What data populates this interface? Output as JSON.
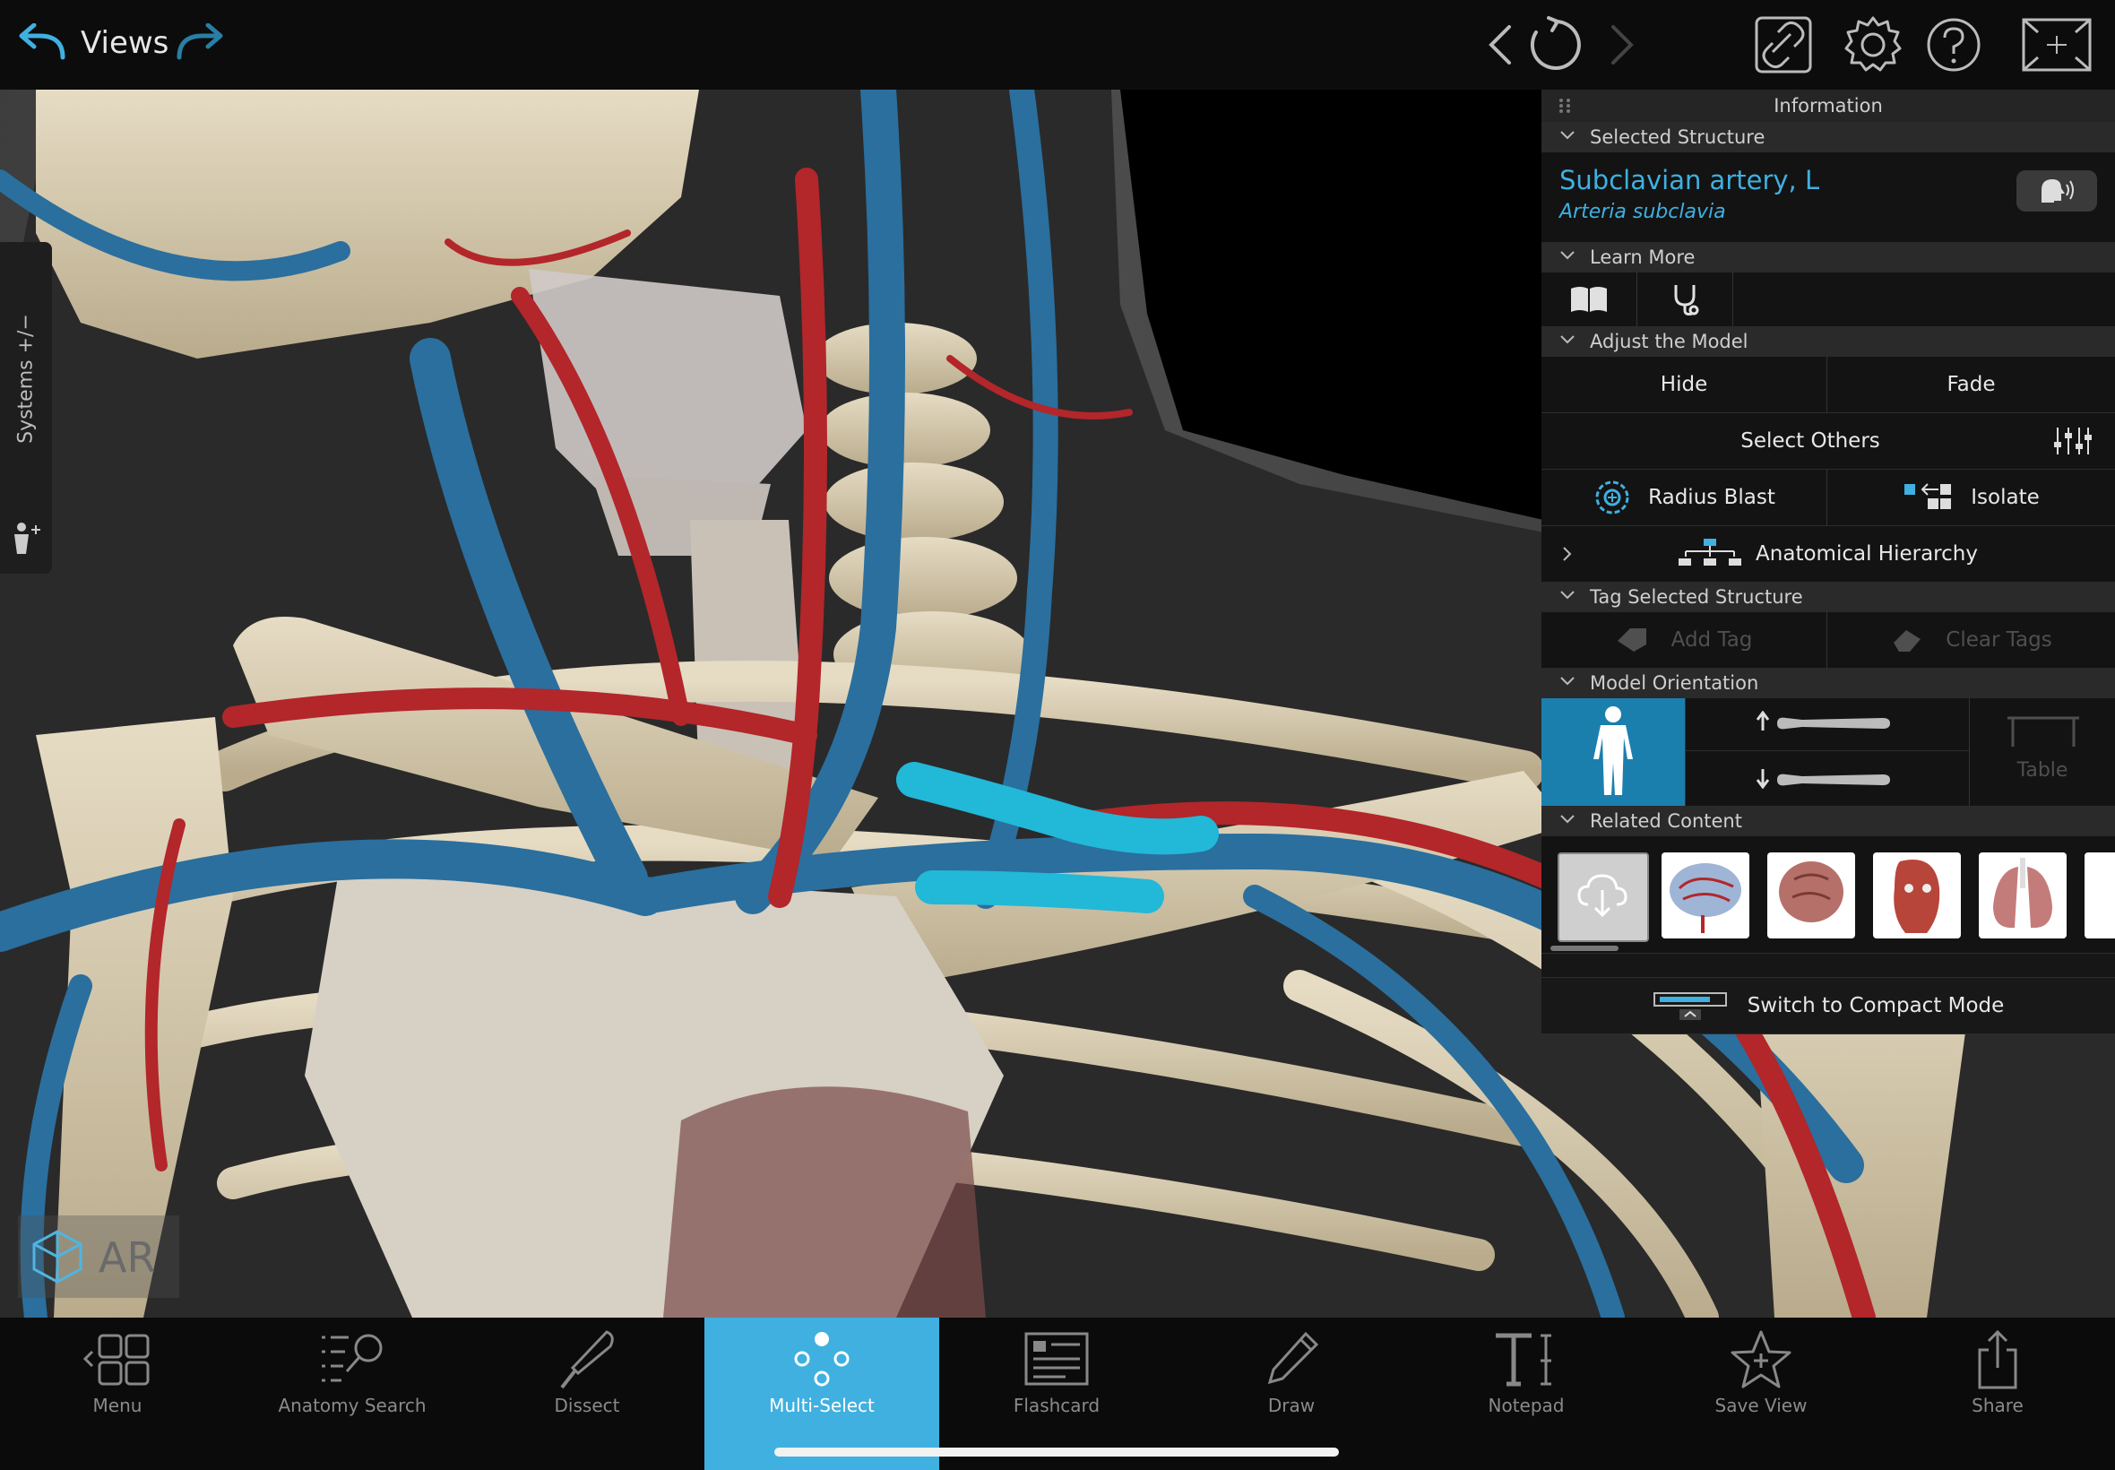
{
  "topbar": {
    "views_label": "Views"
  },
  "systems_tab": {
    "label": "Systems +/−"
  },
  "ar_badge": {
    "label": "AR"
  },
  "panel": {
    "title": "Information",
    "selected_structure": {
      "header": "Selected Structure",
      "name": "Subclavian artery, L",
      "latin": "Arteria subclavia"
    },
    "learn_more": {
      "header": "Learn More"
    },
    "adjust_model": {
      "header": "Adjust the Model",
      "hide": "Hide",
      "fade": "Fade",
      "select_others": "Select Others",
      "radius_blast": "Radius Blast",
      "isolate": "Isolate",
      "anatomical_hierarchy": "Anatomical Hierarchy"
    },
    "tag_structure": {
      "header": "Tag Selected Structure",
      "add_tag": "Add Tag",
      "clear_tags": "Clear Tags"
    },
    "model_orientation": {
      "header": "Model Orientation",
      "table": "Table"
    },
    "related_content": {
      "header": "Related Content"
    },
    "compact_mode": "Switch to Compact Mode"
  },
  "bottombar": {
    "items": [
      {
        "label": "Menu"
      },
      {
        "label": "Anatomy Search"
      },
      {
        "label": "Dissect"
      },
      {
        "label": "Multi-Select"
      },
      {
        "label": "Flashcard"
      },
      {
        "label": "Draw"
      },
      {
        "label": "Notepad"
      },
      {
        "label": "Save View"
      },
      {
        "label": "Share"
      }
    ]
  },
  "colors": {
    "accent": "#3fb0e0",
    "artery": "#b3262a",
    "vein": "#2a6f9e",
    "selected": "#22b8d8",
    "bone": "#d9cdb3"
  }
}
